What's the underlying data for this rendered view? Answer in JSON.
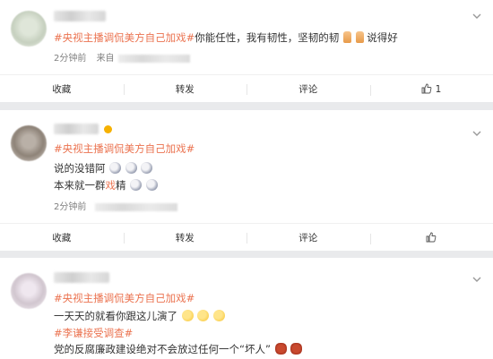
{
  "posts": [
    {
      "hashtag": "#央视主播调侃美方自己加戏#",
      "text": "你能任性，我有韧性，坚韧的韧",
      "text_after": "说得好",
      "time": "2分钟前",
      "time_prefix": "来自",
      "actions": {
        "collect": "收藏",
        "repost": "转发",
        "comment": "评论",
        "like_count": "1"
      }
    },
    {
      "hashtag": "#央视主播调侃美方自己加戏#",
      "line1": "说的没错阿",
      "line2_a": "本来就一群",
      "line2_b": "戏",
      "line2_c": "精",
      "time": "2分钟前",
      "actions": {
        "collect": "收藏",
        "repost": "转发",
        "comment": "评论"
      }
    },
    {
      "hashtag": "#央视主播调侃美方自己加戏#",
      "line1": "一天天的就看你跟这儿演了",
      "hashtag2": "#李谦接受调查#",
      "line3": "党的反腐廉政建设绝对不会放过任何一个“坏人”"
    }
  ]
}
